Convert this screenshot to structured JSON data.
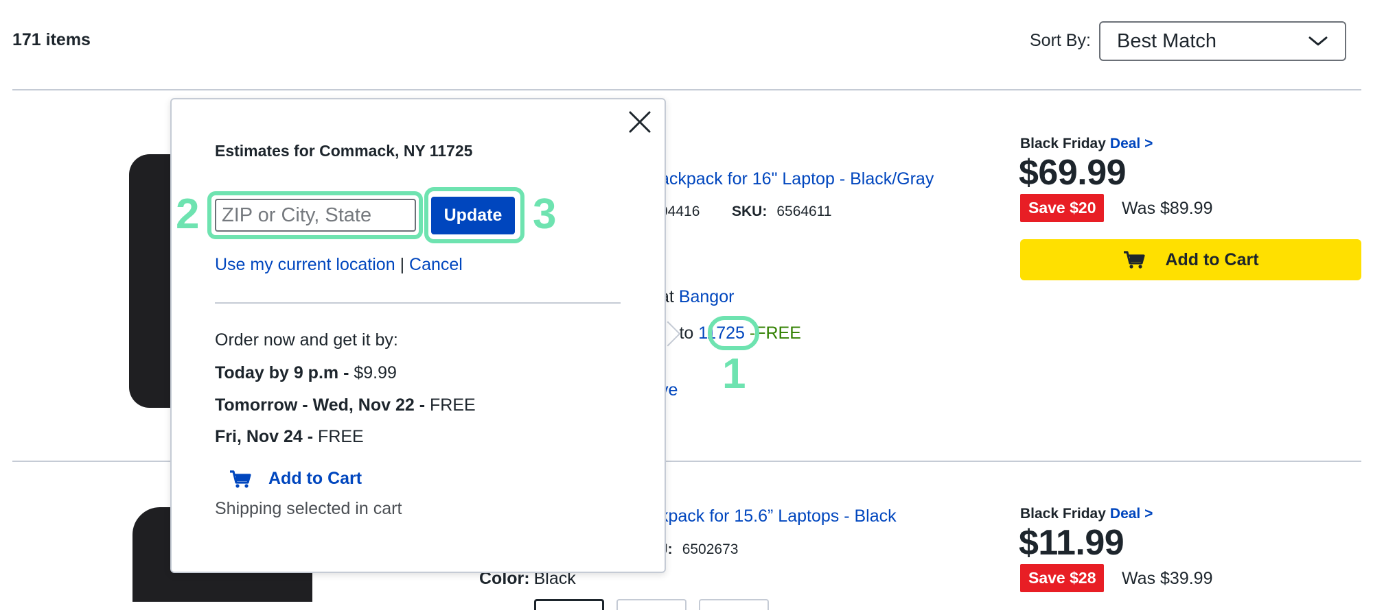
{
  "header": {
    "item_count": "171 items",
    "sort_label": "Sort By:",
    "sort_value": "Best Match"
  },
  "products": [
    {
      "title_visible": "ackpack for 16\" Laptop - Black/Gray",
      "model_partial": "04416",
      "sku_label": "SKU:",
      "sku": "6564611",
      "pickup_prefix": "at",
      "pickup_store": "Bangor",
      "delivery_prefix": "y to",
      "delivery_zip": "11725",
      "delivery_sep": "-",
      "delivery_free": "FREE",
      "save_link_partial": "ve",
      "deal_label": "Black Friday",
      "deal_link": "Deal >",
      "price": "$69.99",
      "save": "Save $20",
      "was": "Was $89.99",
      "add_to_cart": "Add to Cart"
    },
    {
      "title_visible": "kpack for 15.6” Laptops - Black",
      "sku_label_partial": "J:",
      "sku": "6502673",
      "color_label": "Color:",
      "color_value": "Black",
      "deal_label": "Black Friday",
      "deal_link": "Deal >",
      "price": "$11.99",
      "save": "Save $28",
      "was": "Was $39.99"
    }
  ],
  "popover": {
    "title": "Estimates for Commack, NY 11725",
    "zip_placeholder": "ZIP or City, State",
    "update_label": "Update",
    "use_location": "Use my current location",
    "separator": "|",
    "cancel": "Cancel",
    "order_text": "Order now and get it by:",
    "options": [
      {
        "label": "Today by 9 p.m -",
        "price": "$9.99"
      },
      {
        "label": "Tomorrow - Wed, Nov 22 -",
        "price": "FREE"
      },
      {
        "label": "Fri, Nov 24 -",
        "price": "FREE"
      }
    ],
    "add_to_cart": "Add to Cart",
    "shipping_note": "Shipping selected in cart"
  },
  "annotations": [
    "1",
    "2",
    "3"
  ],
  "colors": {
    "link": "#0046be",
    "free": "#318000",
    "sale": "#e81e25",
    "cart_yellow": "#ffe000",
    "annotation": "#6ee3b0"
  }
}
